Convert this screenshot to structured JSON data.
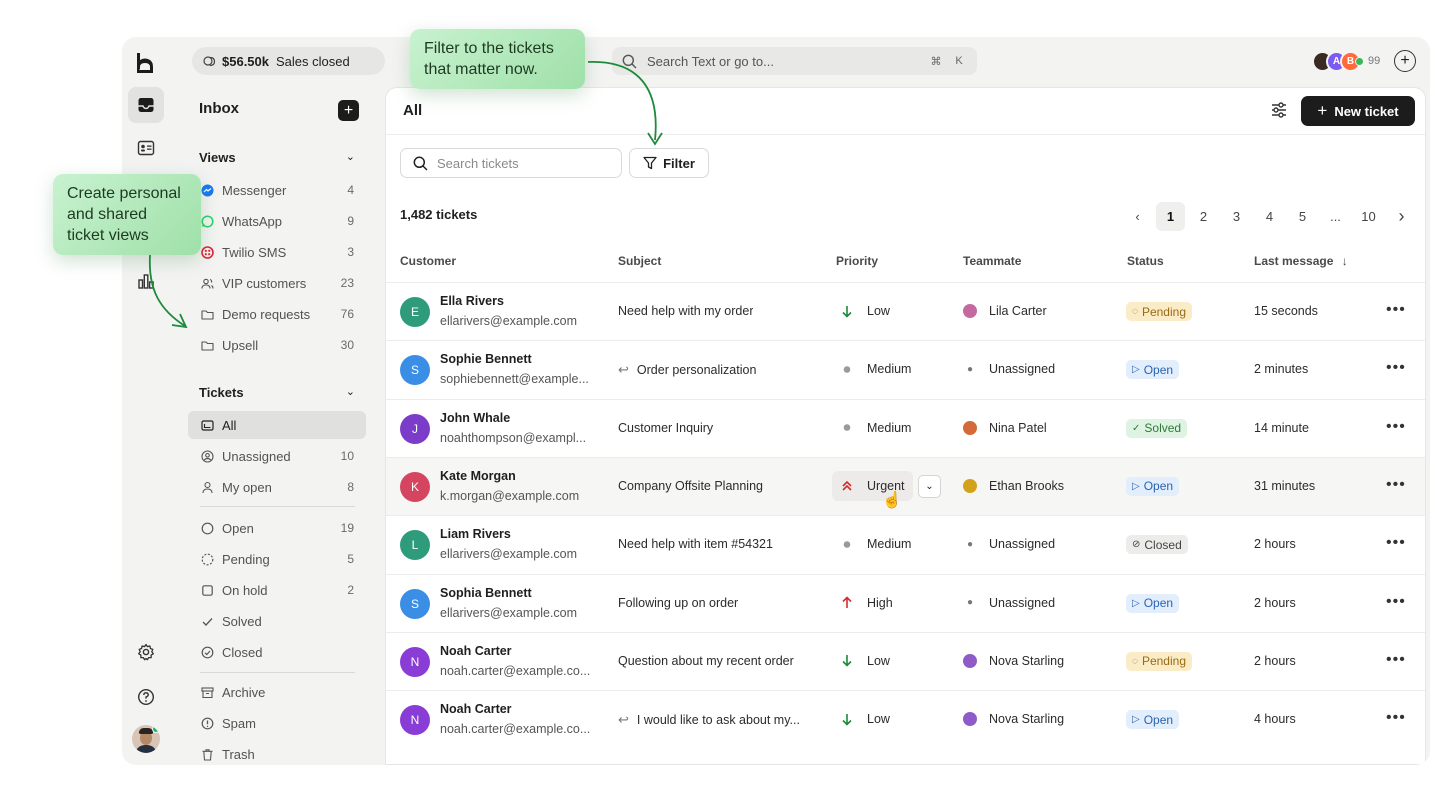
{
  "topbar": {
    "sales_amount": "$56.50k",
    "sales_label": "Sales closed",
    "search_placeholder": "Search Text or go to...",
    "shortcut_keys": [
      "⌘",
      "K"
    ],
    "avatars": [
      {
        "initial": "",
        "color": "#3b2a22"
      },
      {
        "initial": "A",
        "color": "#7c5cf0"
      },
      {
        "initial": "B",
        "color": "#ff6a3d"
      }
    ],
    "avatar_overflow": "99"
  },
  "sidebar": {
    "title": "Inbox",
    "views_header": "Views",
    "views": [
      {
        "label": "Messenger",
        "count": "4",
        "icon": "messenger-icon",
        "color": "#1877f2"
      },
      {
        "label": "WhatsApp",
        "count": "9",
        "icon": "whatsapp-icon",
        "color": "#25d366"
      },
      {
        "label": "Twilio SMS",
        "count": "3",
        "icon": "twilio-icon",
        "color": "#e22134"
      },
      {
        "label": "VIP customers",
        "count": "23",
        "icon": "users-icon"
      },
      {
        "label": "Demo requests",
        "count": "76",
        "icon": "folder-icon"
      },
      {
        "label": "Upsell",
        "count": "30",
        "icon": "folder-icon"
      }
    ],
    "tickets_header": "Tickets",
    "tickets": [
      {
        "label": "All",
        "count": "",
        "icon": "inbox-icon"
      },
      {
        "label": "Unassigned",
        "count": "10",
        "icon": "user-circle-icon"
      },
      {
        "label": "My open",
        "count": "8",
        "icon": "user-icon"
      }
    ],
    "statuses": [
      {
        "label": "Open",
        "count": "19",
        "icon": "circle-icon"
      },
      {
        "label": "Pending",
        "count": "5",
        "icon": "dashed-circle-icon"
      },
      {
        "label": "On hold",
        "count": "2",
        "icon": "square-icon"
      },
      {
        "label": "Solved",
        "count": "",
        "icon": "check-icon"
      },
      {
        "label": "Closed",
        "count": "",
        "icon": "check-circle-icon"
      }
    ],
    "other": [
      {
        "label": "Archive",
        "icon": "archive-icon"
      },
      {
        "label": "Spam",
        "icon": "alert-icon"
      },
      {
        "label": "Trash",
        "icon": "trash-icon"
      }
    ]
  },
  "main": {
    "title": "All",
    "new_ticket_label": "New ticket",
    "search_placeholder": "Search tickets",
    "filter_label": "Filter",
    "ticket_count": "1,482 tickets",
    "pages": [
      "1",
      "2",
      "3",
      "4",
      "5",
      "...",
      "10"
    ],
    "current_page": "1",
    "columns": {
      "customer": "Customer",
      "subject": "Subject",
      "priority": "Priority",
      "teammate": "Teammate",
      "status": "Status",
      "last_message": "Last message"
    },
    "rows": [
      {
        "initial": "E",
        "avatar_color": "#2e9c7a",
        "name": "Ella Rivers",
        "email": "ellarivers@example.com",
        "subject": "Need help with my order",
        "reply": false,
        "priority": "Low",
        "priority_icon": "arrow-down",
        "teammate": "Lila Carter",
        "mate_color": "#c56aa0",
        "status": "Pending",
        "last": "15 seconds"
      },
      {
        "initial": "S",
        "avatar_color": "#3a8ee6",
        "name": "Sophie Bennett",
        "email": "sophiebennett@example...",
        "subject": "Order personalization",
        "reply": true,
        "priority": "Medium",
        "priority_icon": "dot",
        "teammate": "Unassigned",
        "mate_color": "",
        "status": "Open",
        "last": "2 minutes"
      },
      {
        "initial": "J",
        "avatar_color": "#7a3cc9",
        "name": "John Whale",
        "email": "noahthompson@exampl...",
        "subject": "Customer Inquiry",
        "reply": false,
        "priority": "Medium",
        "priority_icon": "dot",
        "teammate": "Nina Patel",
        "mate_color": "#d46a3a",
        "status": "Solved",
        "last": "14 minute"
      },
      {
        "initial": "K",
        "avatar_color": "#d6455f",
        "name": "Kate Morgan",
        "email": "k.morgan@example.com",
        "subject": "Company Offsite Planning",
        "reply": false,
        "priority": "Urgent",
        "priority_icon": "double-up",
        "teammate": "Ethan Brooks",
        "mate_color": "#d4a21a",
        "status": "Open",
        "last": "31 minutes"
      },
      {
        "initial": "L",
        "avatar_color": "#2e9c7a",
        "name": "Liam Rivers",
        "email": "ellarivers@example.com",
        "subject": "Need help with item #54321",
        "reply": false,
        "priority": "Medium",
        "priority_icon": "dot",
        "teammate": "Unassigned",
        "mate_color": "",
        "status": "Closed",
        "last": "2 hours"
      },
      {
        "initial": "S",
        "avatar_color": "#3a8ee6",
        "name": "Sophia Bennett",
        "email": "ellarivers@example.com",
        "subject": "Following up on order",
        "reply": false,
        "priority": "High",
        "priority_icon": "arrow-up",
        "teammate": "Unassigned",
        "mate_color": "",
        "status": "Open",
        "last": "2 hours"
      },
      {
        "initial": "N",
        "avatar_color": "#8a3cd6",
        "name": "Noah Carter",
        "email": "noah.carter@example.co...",
        "subject": "Question about my recent order",
        "reply": false,
        "priority": "Low",
        "priority_icon": "arrow-down",
        "teammate": "Nova Starling",
        "mate_color": "#8e5bc9",
        "status": "Pending",
        "last": "2 hours"
      },
      {
        "initial": "N",
        "avatar_color": "#8a3cd6",
        "name": "Noah Carter",
        "email": "noah.carter@example.co...",
        "subject": "I would like to ask about my...",
        "reply": true,
        "priority": "Low",
        "priority_icon": "arrow-down",
        "teammate": "Nova Starling",
        "mate_color": "#8e5bc9",
        "status": "Open",
        "last": "4 hours"
      }
    ]
  },
  "callouts": {
    "filter": "Filter to the tickets\nthat matter now.",
    "views": "Create personal\nand shared\nticket views"
  }
}
